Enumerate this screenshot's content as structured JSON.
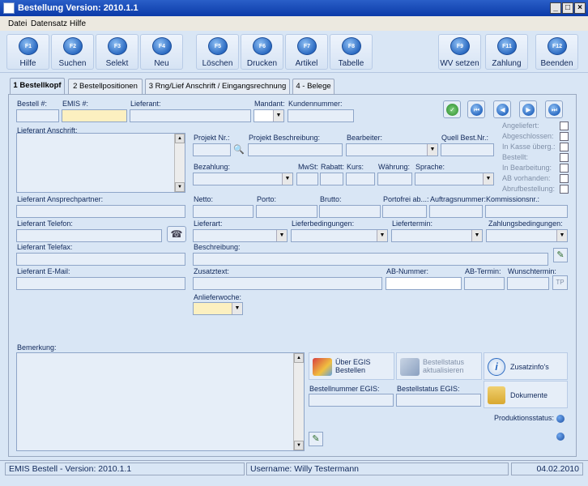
{
  "window": {
    "title": "Bestellung Version: 2010.1.1",
    "btn_min": "_",
    "btn_max": "□",
    "btn_close": "×"
  },
  "menu": {
    "datei": "Datei",
    "datensatz": "Datensatz",
    "hilfe": "Hilfe"
  },
  "toolbar": [
    {
      "key": "F1",
      "label": "Hilfe"
    },
    {
      "key": "F2",
      "label": "Suchen"
    },
    {
      "key": "F3",
      "label": "Selekt"
    },
    {
      "key": "F4",
      "label": "Neu"
    },
    {
      "key": "F5",
      "label": "Löschen"
    },
    {
      "key": "F6",
      "label": "Drucken"
    },
    {
      "key": "F7",
      "label": "Artikel"
    },
    {
      "key": "F8",
      "label": "Tabelle"
    },
    {
      "key": "F9",
      "label": "WV setzen"
    },
    {
      "key": "F11",
      "label": "Zahlung"
    },
    {
      "key": "F12",
      "label": "Beenden"
    }
  ],
  "tabs": [
    "1 Bestellkopf",
    "2 Bestellpositionen",
    "3 Rng/Lief Anschrift / Eingangsrechnung",
    "4 - Belege"
  ],
  "form": {
    "bestell_nr": "Bestell #:",
    "emis_nr": "EMIS #:",
    "lieferant": "Lieferant:",
    "mandant": "Mandant:",
    "kundennummer": "Kundennummer:",
    "anschrift": "Lieferant Anschrift:",
    "projekt_nr": "Projekt Nr.:",
    "projekt_beschreibung": "Projekt Beschreibung:",
    "bearbeiter": "Bearbeiter:",
    "quell_best": "Quell Best.Nr.:",
    "bezahlung": "Bezahlung:",
    "mwst": "MwSt:",
    "rabatt": "Rabatt:",
    "kurs": "Kurs:",
    "waehrung": "Währung:",
    "sprache": "Sprache:",
    "ansprechpartner": "Lieferant Ansprechpartner:",
    "netto": "Netto:",
    "porto": "Porto:",
    "brutto": "Brutto:",
    "portofrei": "Portofrei ab...:",
    "auftragsnummer": "Auftragsnummer:",
    "kommissionsnr": "Kommissionsnr.:",
    "telefon": "Lieferant Telefon:",
    "lieferart": "Lieferart:",
    "lieferbedingungen": "Lieferbedingungen:",
    "liefertermin": "Liefertermin:",
    "zahlungsbedingungen": "Zahlungsbedingungen:",
    "telefax": "Lieferant Telefax:",
    "beschreibung": "Beschreibung:",
    "email": "Lieferant E-Mail:",
    "zusatztext": "Zusatztext:",
    "ab_nummer": "AB-Nummer:",
    "ab_termin": "AB-Termin:",
    "wunschtermin": "Wunschtermin:",
    "tp": "TP",
    "anlieferwoche": "Anlieferwoche:",
    "bemerkung": "Bemerkung:"
  },
  "status_flags": [
    "Angeliefert:",
    "Abgeschlossen:",
    "In Kasse überg.:",
    "Bestellt:",
    "In Bearbeitung:",
    "AB vorhanden:",
    "Abrufbestellung:"
  ],
  "actions": {
    "ueber_egis": "Über EGIS\nBestellen",
    "bestellstatus_aktualisieren": "Bestellstatus\naktualisieren",
    "zusatzinfos": "Zusatzinfo's",
    "bestellnummer_egis": "Bestellnummer EGIS:",
    "bestellstatus_egis": "Bestellstatus EGIS:",
    "dokumente": "Dokumente",
    "produktionsstatus": "Produktionsstatus:"
  },
  "statusbar": {
    "app": "EMIS Bestell - Version: 2010.1.1",
    "user": "Username: Willy Testermann",
    "date": "04.02.2010"
  }
}
